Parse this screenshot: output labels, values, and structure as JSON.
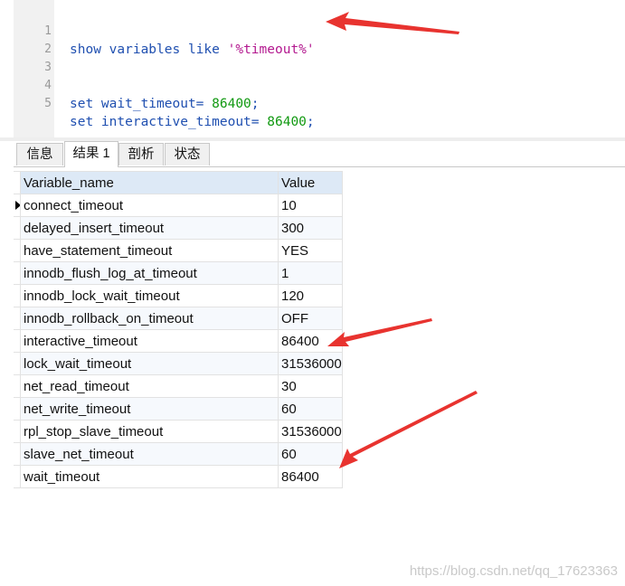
{
  "editor": {
    "lines": [
      {
        "num": "1",
        "kw": "show variables like ",
        "num_val": "",
        "str": "'%timeout%'",
        "end": ""
      },
      {
        "num": "2",
        "kw": "",
        "num_val": "",
        "str": "",
        "end": ""
      },
      {
        "num": "3",
        "kw": "",
        "num_val": "",
        "str": "",
        "end": ""
      },
      {
        "num": "4",
        "kw": "set wait_timeout= ",
        "num_val": "86400",
        "str": "",
        "end": ";"
      },
      {
        "num": "5",
        "kw": "set interactive_timeout= ",
        "num_val": "86400",
        "str": "",
        "end": ";"
      }
    ]
  },
  "tabs": [
    {
      "label": "信息"
    },
    {
      "label": "结果 1"
    },
    {
      "label": "剖析"
    },
    {
      "label": "状态"
    }
  ],
  "active_tab": "结果 1",
  "grid": {
    "headers": {
      "name": "Variable_name",
      "value": "Value"
    },
    "rows": [
      {
        "name": "connect_timeout",
        "value": "10"
      },
      {
        "name": "delayed_insert_timeout",
        "value": "300"
      },
      {
        "name": "have_statement_timeout",
        "value": "YES"
      },
      {
        "name": "innodb_flush_log_at_timeout",
        "value": "1"
      },
      {
        "name": "innodb_lock_wait_timeout",
        "value": "120"
      },
      {
        "name": "innodb_rollback_on_timeout",
        "value": "OFF"
      },
      {
        "name": "interactive_timeout",
        "value": "86400"
      },
      {
        "name": "lock_wait_timeout",
        "value": "31536000"
      },
      {
        "name": "net_read_timeout",
        "value": "30"
      },
      {
        "name": "net_write_timeout",
        "value": "60"
      },
      {
        "name": "rpl_stop_slave_timeout",
        "value": "31536000"
      },
      {
        "name": "slave_net_timeout",
        "value": "60"
      },
      {
        "name": "wait_timeout",
        "value": "86400"
      }
    ]
  },
  "watermark": "https://blog.csdn.net/qq_17623363",
  "colors": {
    "keyword": "#1f4fb0",
    "number": "#119911",
    "string": "#b3188f",
    "arrow": "#e8332f",
    "header_bg": "#dde9f6"
  }
}
